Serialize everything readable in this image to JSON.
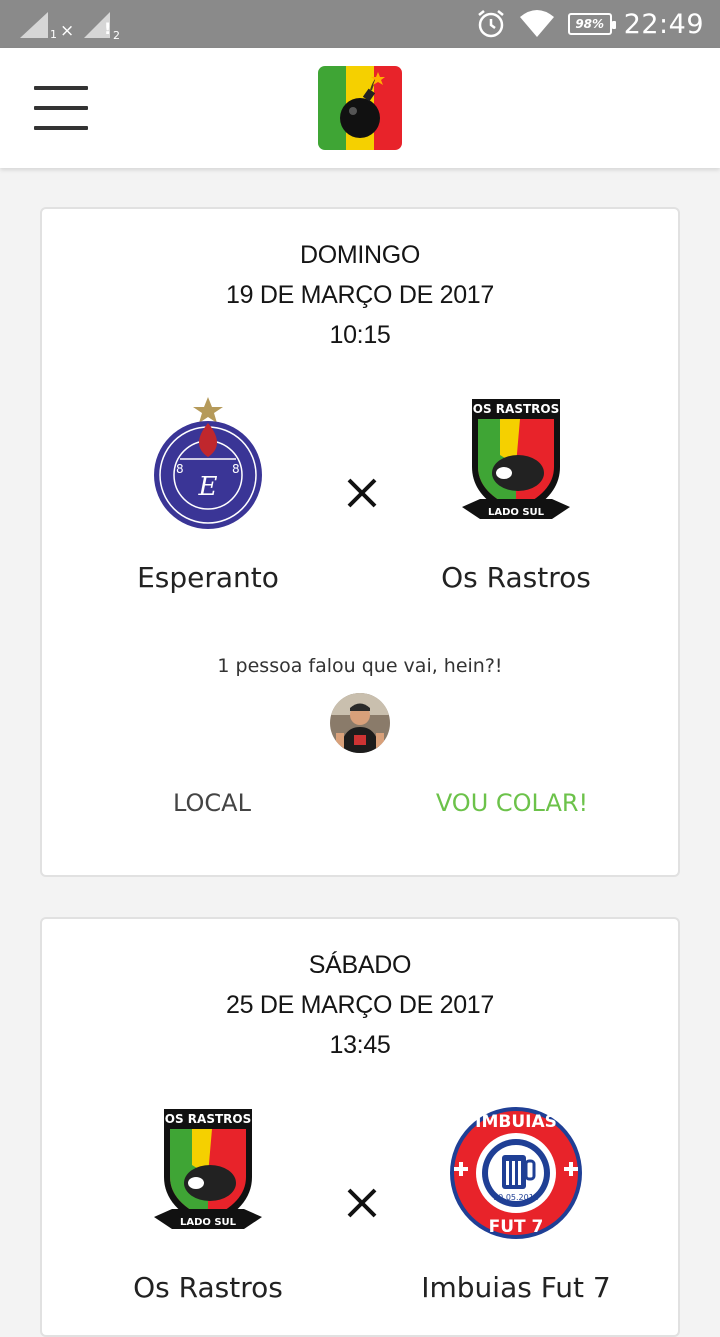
{
  "status_bar": {
    "time": "22:49",
    "battery": "98%",
    "sim1_label": "1",
    "sim2_label": "2"
  },
  "app_bar": {
    "menu_icon": "hamburger-menu-icon",
    "logo": "bomb-logo"
  },
  "matches": [
    {
      "day": "DOMINGO",
      "date": "19 DE MARÇO DE 2017",
      "time": "10:15",
      "home_team": "Esperanto",
      "away_team": "Os Rastros",
      "versus_symbol": "×",
      "attendance_text": "1 pessoa falou que vai, hein?!",
      "local_label": "LOCAL",
      "going_label": "VOU COLAR!"
    },
    {
      "day": "SÁBADO",
      "date": "25 DE MARÇO DE 2017",
      "time": "13:45",
      "home_team": "Os Rastros",
      "away_team": "Imbuias Fut 7",
      "versus_symbol": "×"
    }
  ],
  "crests": {
    "os_rastros": {
      "top": "OS RASTROS",
      "bottom": "LADO SUL"
    },
    "imbuias": {
      "top": "IMBUIAS",
      "bottom": "FUT 7",
      "date": "10.05.2016"
    }
  },
  "colors": {
    "accent_green": "#6cc24a",
    "status_bar": "#8a8a8a"
  }
}
